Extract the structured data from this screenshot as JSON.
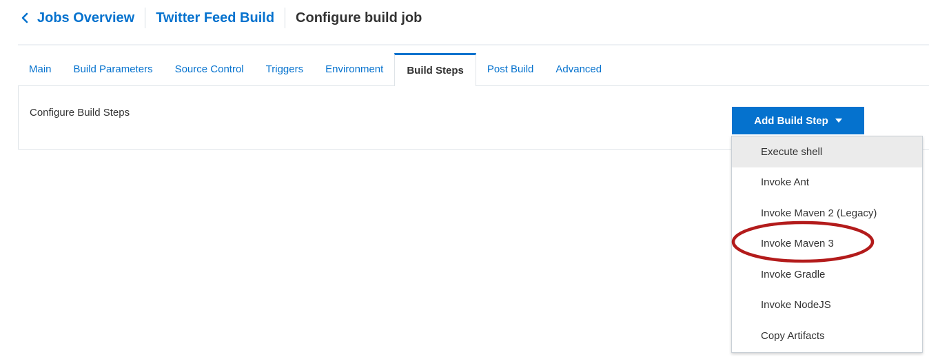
{
  "breadcrumb": {
    "back_label": "Jobs Overview",
    "project_label": "Twitter Feed Build",
    "current_label": "Configure build job"
  },
  "tabs": [
    {
      "label": "Main",
      "active": false
    },
    {
      "label": "Build Parameters",
      "active": false
    },
    {
      "label": "Source Control",
      "active": false
    },
    {
      "label": "Triggers",
      "active": false
    },
    {
      "label": "Environment",
      "active": false
    },
    {
      "label": "Build Steps",
      "active": true
    },
    {
      "label": "Post Build",
      "active": false
    },
    {
      "label": "Advanced",
      "active": false
    }
  ],
  "panel": {
    "title": "Configure Build Steps"
  },
  "add_button": {
    "label": "Add Build Step",
    "icon": "caret-down-icon"
  },
  "menu": {
    "items": [
      {
        "label": "Execute shell",
        "highlighted": true
      },
      {
        "label": "Invoke Ant",
        "highlighted": false
      },
      {
        "label": "Invoke Maven 2 (Legacy)",
        "highlighted": false
      },
      {
        "label": "Invoke Maven 3",
        "highlighted": false,
        "annotated": true
      },
      {
        "label": "Invoke Gradle",
        "highlighted": false
      },
      {
        "label": "Invoke NodeJS",
        "highlighted": false
      },
      {
        "label": "Copy Artifacts",
        "highlighted": false
      }
    ]
  },
  "colors": {
    "accent": "#0572ce",
    "annotation": "#b31b1b",
    "menu_highlight": "#ebebeb"
  }
}
